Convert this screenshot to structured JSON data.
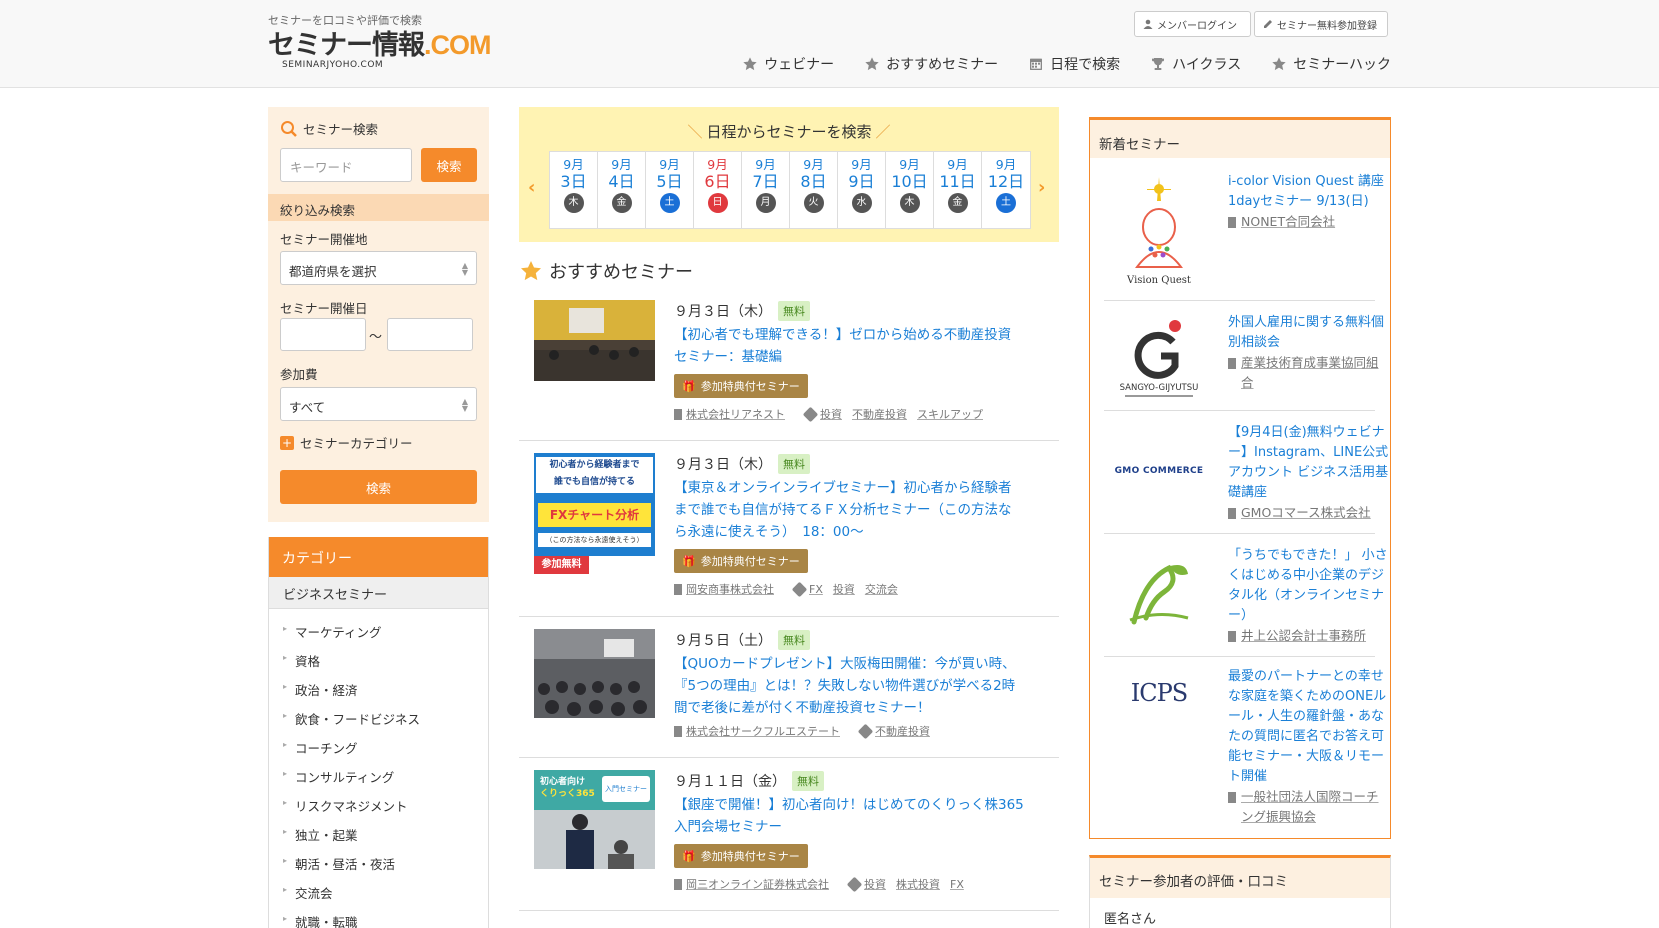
{
  "header": {
    "tagline": "セミナーを口コミや評価で検索",
    "logo_main": "セミナー情報",
    "logo_com": ".COM",
    "logo_sub": "SEMINARJYOHO.COM",
    "login_btn": "メンバーログイン",
    "register_btn": "セミナー無料参加登録",
    "nav": [
      {
        "label": "ウェビナー",
        "icon": "star-icon"
      },
      {
        "label": "おすすめセミナー",
        "icon": "star-icon"
      },
      {
        "label": "日程で検索",
        "icon": "calendar-icon"
      },
      {
        "label": "ハイクラス",
        "icon": "trophy-icon"
      },
      {
        "label": "セミナーハック",
        "icon": "star-icon"
      }
    ]
  },
  "search": {
    "title": "セミナー検索",
    "keyword_placeholder": "キーワード",
    "keyword_btn": "検索",
    "narrow": "絞り込み検索",
    "place_label": "セミナー開催地",
    "place_value": "都道府県を選択",
    "date_label": "セミナー開催日",
    "date_sep": "〜",
    "fee_label": "参加費",
    "fee_value": "すべて",
    "category_toggle": "セミナーカテゴリー",
    "submit": "検索"
  },
  "categories": {
    "header": "カテゴリー",
    "sub": "ビジネスセミナー",
    "items": [
      "マーケティング",
      "資格",
      "政治・経済",
      "飲食・フードビジネス",
      "コーチング",
      "コンサルティング",
      "リスクマネジメント",
      "独立・起業",
      "朝活・昼活・夜活",
      "交流会",
      "就職・転職"
    ]
  },
  "calendar": {
    "title": "日程からセミナーを検索",
    "days": [
      {
        "m": "9月",
        "d": "3日",
        "w": "木",
        "type": "weekday"
      },
      {
        "m": "9月",
        "d": "4日",
        "w": "金",
        "type": "weekday"
      },
      {
        "m": "9月",
        "d": "5日",
        "w": "土",
        "type": "sat"
      },
      {
        "m": "9月",
        "d": "6日",
        "w": "日",
        "type": "sun"
      },
      {
        "m": "9月",
        "d": "7日",
        "w": "月",
        "type": "weekday"
      },
      {
        "m": "9月",
        "d": "8日",
        "w": "火",
        "type": "weekday"
      },
      {
        "m": "9月",
        "d": "9日",
        "w": "水",
        "type": "weekday"
      },
      {
        "m": "9月",
        "d": "10日",
        "w": "木",
        "type": "weekday"
      },
      {
        "m": "9月",
        "d": "11日",
        "w": "金",
        "type": "weekday"
      },
      {
        "m": "9月",
        "d": "12日",
        "w": "土",
        "type": "sat"
      }
    ]
  },
  "recommended": {
    "heading": "おすすめセミナー",
    "items": [
      {
        "date": "９月３日（木）",
        "badge": "無料",
        "title": "【初心者でも理解できる！】ゼロから始める不動産投資セミナー：基礎編",
        "gift": "参加特典付セミナー",
        "org": "株式会社リアネスト",
        "tags": [
          "投資",
          "不動産投資",
          "スキルアップ"
        ]
      },
      {
        "date": "９月３日（木）",
        "badge": "無料",
        "title": "【東京＆オンラインライブセミナー】初心者から経験者まで誰でも自信が持てるＦＸ分析セミナー（この方法なら永遠に使えそう）　18：00〜",
        "gift": "参加特典付セミナー",
        "org": "岡安商事株式会社",
        "tags": [
          "FX",
          "投資",
          "交流会"
        ],
        "thumb_lines": [
          "初心者から経験者まで",
          "誰でも自信が持てる",
          "FXチャート分析",
          "（この方法なら永遠使えそう）",
          "参加無料"
        ]
      },
      {
        "date": "９月５日（土）",
        "badge": "無料",
        "title": "【QUOカードプレゼント】大阪梅田開催：今が買い時、『5つの理由』とは！？失敗しない物件選びが学べる2時間で老後に差が付く不動産投資セミナー！",
        "gift": "",
        "org": "株式会社サークフルエステート",
        "tags": [
          "不動産投資"
        ]
      },
      {
        "date": "９月１１日（金）",
        "badge": "無料",
        "title": "【銀座で開催！】初心者向け！はじめてのくりっく株365入門会場セミナー",
        "gift": "参加特典付セミナー",
        "org": "岡三オンライン証券株式会社",
        "tags": [
          "投資",
          "株式投資",
          "FX"
        ],
        "thumb_lines": [
          "初心者向け",
          "くりっく365",
          "入門セミナー"
        ]
      }
    ]
  },
  "new_seminars": {
    "heading": "新着セミナー",
    "items": [
      {
        "logo": "Vision Quest",
        "title": "i-color Vision Quest 講座1dayセミナー 9/13(日)",
        "org": "NONET合同会社"
      },
      {
        "logo": "SANGYO-GIJYUTSU",
        "title": "外国人雇用に関する無料個別相談会",
        "org": "産業技術育成事業協同組合"
      },
      {
        "logo": "GMO COMMERCE",
        "title": "【9月4日(金)無料ウェビナー】Instagram、LINE公式アカウント ビジネス活用基礎講座",
        "org": "GMOコマース株式会社"
      },
      {
        "logo": "",
        "title": "「うちでもできた！」 小さくはじめる中小企業のデジタル化（オンラインセミナー）",
        "org": "井上公認会計士事務所"
      },
      {
        "logo": "ICPS",
        "title": "最愛のパートナーとの幸せな家庭を築くためのONEルール・人生の羅針盤・あなたの質問に匿名でお答え可能セミナー・大阪＆リモート開催",
        "org": "一般社団法人国際コーチング振興協会"
      }
    ]
  },
  "reviews": {
    "heading": "セミナー参加者の評価・口コミ",
    "user": "匿名さん"
  },
  "colors": {
    "accent": "#f58a2b",
    "link": "#1a7fd6",
    "gift": "#a98545",
    "calendar_bg": "#fff3b3"
  }
}
